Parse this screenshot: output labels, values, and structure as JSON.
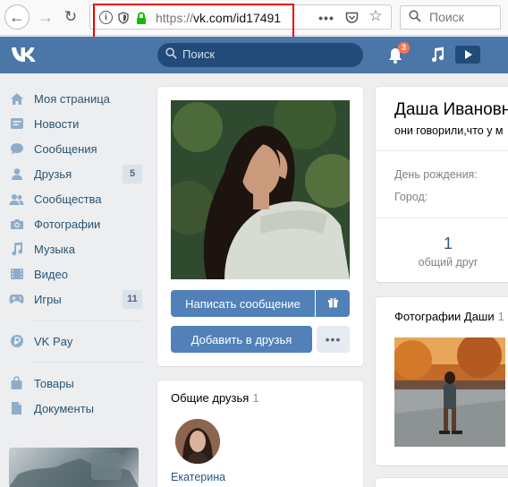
{
  "browser": {
    "url_scheme": "https://",
    "url_host": "vk.com",
    "url_path": "/id17491",
    "search_placeholder": "Поиск"
  },
  "header": {
    "search_placeholder": "Поиск",
    "notification_count": "3",
    "brand_color": "#4a76a8"
  },
  "sidebar": {
    "items": [
      {
        "label": "Моя страница",
        "icon": "home-icon"
      },
      {
        "label": "Новости",
        "icon": "news-icon"
      },
      {
        "label": "Сообщения",
        "icon": "messages-icon"
      },
      {
        "label": "Друзья",
        "icon": "friends-icon",
        "count": "5"
      },
      {
        "label": "Сообщества",
        "icon": "groups-icon"
      },
      {
        "label": "Фотографии",
        "icon": "camera-icon"
      },
      {
        "label": "Музыка",
        "icon": "music-icon"
      },
      {
        "label": "Видео",
        "icon": "video-icon"
      },
      {
        "label": "Игры",
        "icon": "gamepad-icon",
        "count": "11"
      },
      {
        "label": "VK Pay",
        "icon": "ruble-icon"
      },
      {
        "label": "Товары",
        "icon": "bag-icon"
      },
      {
        "label": "Документы",
        "icon": "document-icon"
      }
    ]
  },
  "profile": {
    "name": "Даша Ивановн",
    "status": "они говорили,что у м",
    "birthday_label": "День рождения:",
    "city_label": "Город:",
    "mutual_count": "1",
    "mutual_label": "общий друг",
    "send_message": "Написать сообщение",
    "add_friend": "Добавить в друзья",
    "more_label": "•••"
  },
  "friends": {
    "title": "Общие друзья",
    "count": "1",
    "friend_name": "Екатерина"
  },
  "photos": {
    "title": "Фотографии Даши",
    "count": "1"
  }
}
